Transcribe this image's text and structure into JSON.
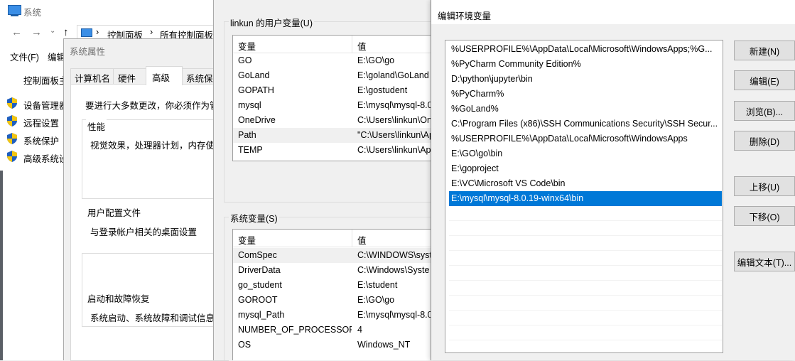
{
  "system_window": {
    "title": "系统",
    "back_arrow": "←",
    "forward_arrow": "→",
    "up_arrow": "↑",
    "breadcrumb": [
      "控制面板",
      "所有控制面板项"
    ],
    "breadcrumb_sep": "›",
    "menu": [
      "文件(F)",
      "编辑"
    ],
    "home_link": "控制面板主",
    "side_links": [
      "设备管理器",
      "远程设置",
      "系统保护",
      "高级系统设"
    ]
  },
  "system_properties": {
    "title": "系统属性",
    "tabs": [
      "计算机名",
      "硬件",
      "高级",
      "系统保护"
    ],
    "admin_note": "要进行大多数更改，你必须作为管",
    "sections": [
      {
        "label": "性能",
        "desc": "视觉效果，处理器计划，内存使用"
      },
      {
        "label": "用户配置文件",
        "desc": "与登录帐户相关的桌面设置"
      },
      {
        "label": "启动和故障恢复",
        "desc": "系统启动、系统故障和调试信息"
      }
    ]
  },
  "env_vars_dialog": {
    "user_group_label": "linkun 的用户变量(U)",
    "sys_group_label": "系统变量(S)",
    "col_var": "变量",
    "col_val": "值",
    "user_vars": [
      {
        "name": "GO",
        "value": "E:\\GO\\go"
      },
      {
        "name": "GoLand",
        "value": "E:\\goland\\GoLand"
      },
      {
        "name": "GOPATH",
        "value": "E:\\gostudent"
      },
      {
        "name": "mysql",
        "value": "E:\\mysql\\mysql-8.0"
      },
      {
        "name": "OneDrive",
        "value": "C:\\Users\\linkun\\On"
      },
      {
        "name": "Path",
        "value": "\"C:\\Users\\linkun\\Ap"
      },
      {
        "name": "TEMP",
        "value": "C:\\Users\\linkun\\Ap"
      }
    ],
    "sys_vars": [
      {
        "name": "ComSpec",
        "value": "C:\\WINDOWS\\syst"
      },
      {
        "name": "DriverData",
        "value": "C:\\Windows\\Syste"
      },
      {
        "name": "go_student",
        "value": "E:\\student"
      },
      {
        "name": "GOROOT",
        "value": "E:\\GO\\go"
      },
      {
        "name": "mysql_Path",
        "value": "E:\\mysql\\mysql-8.0"
      },
      {
        "name": "NUMBER_OF_PROCESSORS",
        "value": "4"
      },
      {
        "name": "OS",
        "value": "Windows_NT"
      }
    ]
  },
  "edit_env_dialog": {
    "title": "编辑环境变量",
    "paths": [
      "%USERPROFILE%\\AppData\\Local\\Microsoft\\WindowsApps;%G...",
      "%PyCharm Community Edition%",
      "D:\\python\\jupyter\\bin",
      "%PyCharm%",
      "%GoLand%",
      "C:\\Program Files (x86)\\SSH Communications Security\\SSH Secur...",
      "%USERPROFILE%\\AppData\\Local\\Microsoft\\WindowsApps",
      "E:\\GO\\go\\bin",
      "E:\\goproject",
      "E:\\VC\\Microsoft VS Code\\bin",
      "E:\\mysql\\mysql-8.0.19-winx64\\bin"
    ],
    "buttons": {
      "new": "新建(N)",
      "edit": "编辑(E)",
      "browse": "浏览(B)...",
      "delete": "删除(D)",
      "move_up": "上移(U)",
      "move_down": "下移(O)",
      "edit_text": "编辑文本(T)..."
    }
  },
  "colors": {
    "selection": "#0078d7",
    "hover": "#e5f3ff",
    "shield_blue": "#1f5fbf",
    "shield_yellow": "#f2c511"
  }
}
